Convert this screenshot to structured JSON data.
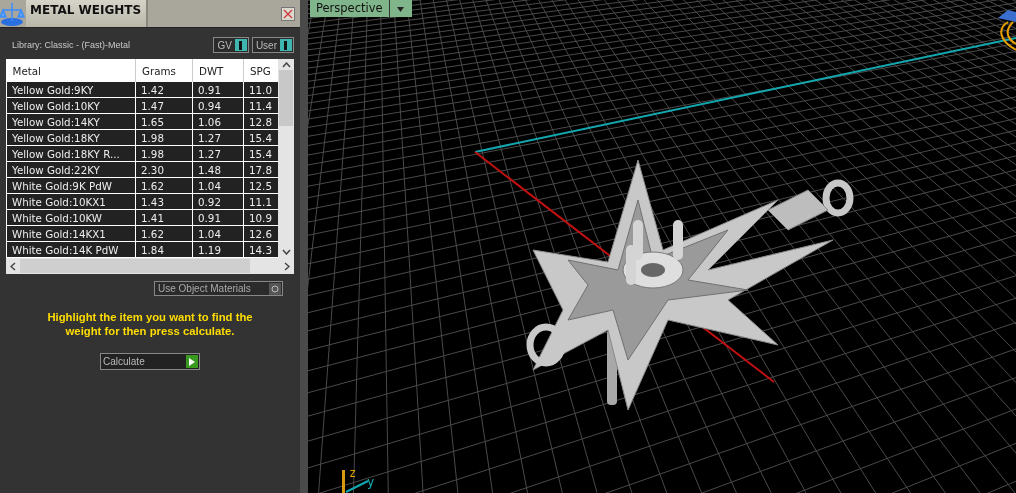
{
  "panel": {
    "title": "METAL WEIGHTS",
    "library": "Library: Classic - (Fast)-Metal",
    "toggles": [
      {
        "label": "GV",
        "on": true
      },
      {
        "label": "User",
        "on": true
      }
    ],
    "table": {
      "columns": [
        "Metal",
        "Grams",
        "DWT",
        "SPG"
      ],
      "rows": [
        [
          "Yellow Gold:9KY",
          "1.42",
          "0.91",
          "11.0"
        ],
        [
          "Yellow Gold:10KY",
          "1.47",
          "0.94",
          "11.4"
        ],
        [
          "Yellow Gold:14KY",
          "1.65",
          "1.06",
          "12.8"
        ],
        [
          "Yellow Gold:18KY",
          "1.98",
          "1.27",
          "15.4"
        ],
        [
          "Yellow Gold:18KY R...",
          "1.98",
          "1.27",
          "15.4"
        ],
        [
          "Yellow Gold:22KY",
          "2.30",
          "1.48",
          "17.8"
        ],
        [
          "White Gold:9K PdW",
          "1.62",
          "1.04",
          "12.5"
        ],
        [
          "White Gold:10KX1",
          "1.43",
          "0.92",
          "11.1"
        ],
        [
          "White Gold:10KW",
          "1.41",
          "0.91",
          "10.9"
        ],
        [
          "White Gold:14KX1",
          "1.62",
          "1.04",
          "12.6"
        ],
        [
          "White Gold:14K PdW",
          "1.84",
          "1.19",
          "14.3"
        ]
      ]
    },
    "use_object_materials": {
      "label": "Use Object Materials",
      "on": false
    },
    "hint": "Highlight the item you want to find the weight for then press calculate.",
    "calculate": "Calculate"
  },
  "viewport": {
    "view": "Perspective",
    "gizmo": {
      "z": "z",
      "y": "y"
    }
  }
}
